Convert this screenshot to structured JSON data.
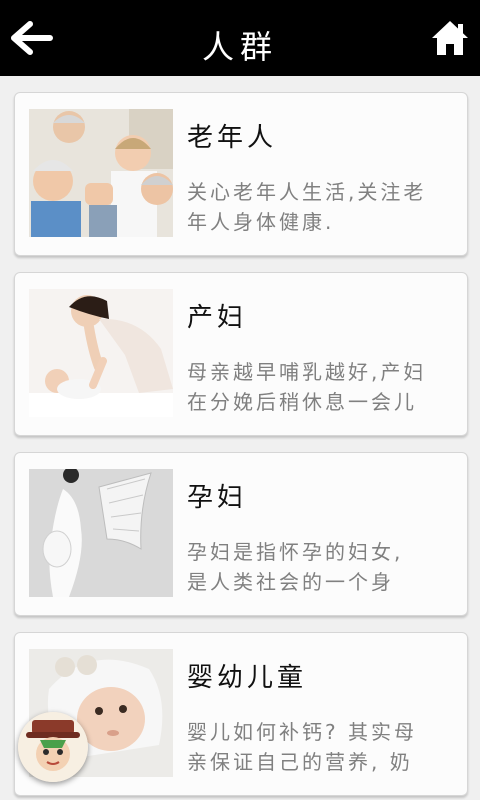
{
  "header": {
    "title": "人群",
    "back_icon": "arrow-left-icon",
    "home_icon": "home-icon"
  },
  "cards": [
    {
      "title": "老年人",
      "desc_line1": "关心老年人生活,关注老",
      "desc_line2": "年人身体健康."
    },
    {
      "title": "产妇",
      "desc_line1": "母亲越早哺乳越好,产妇",
      "desc_line2": "在分娩后稍休息一会儿"
    },
    {
      "title": "孕妇",
      "desc_line1": "孕妇是指怀孕的妇女,",
      "desc_line2": "是人类社会的一个身"
    },
    {
      "title": "婴幼儿童",
      "desc_line1": "婴儿如何补钙? 其实母",
      "desc_line2": "亲保证自己的营养, 奶"
    }
  ],
  "colors": {
    "header_bg": "#000000",
    "card_bg": "#fcfcfc",
    "desc_text": "#808080"
  },
  "floating_button_icon": "avatar-icon"
}
